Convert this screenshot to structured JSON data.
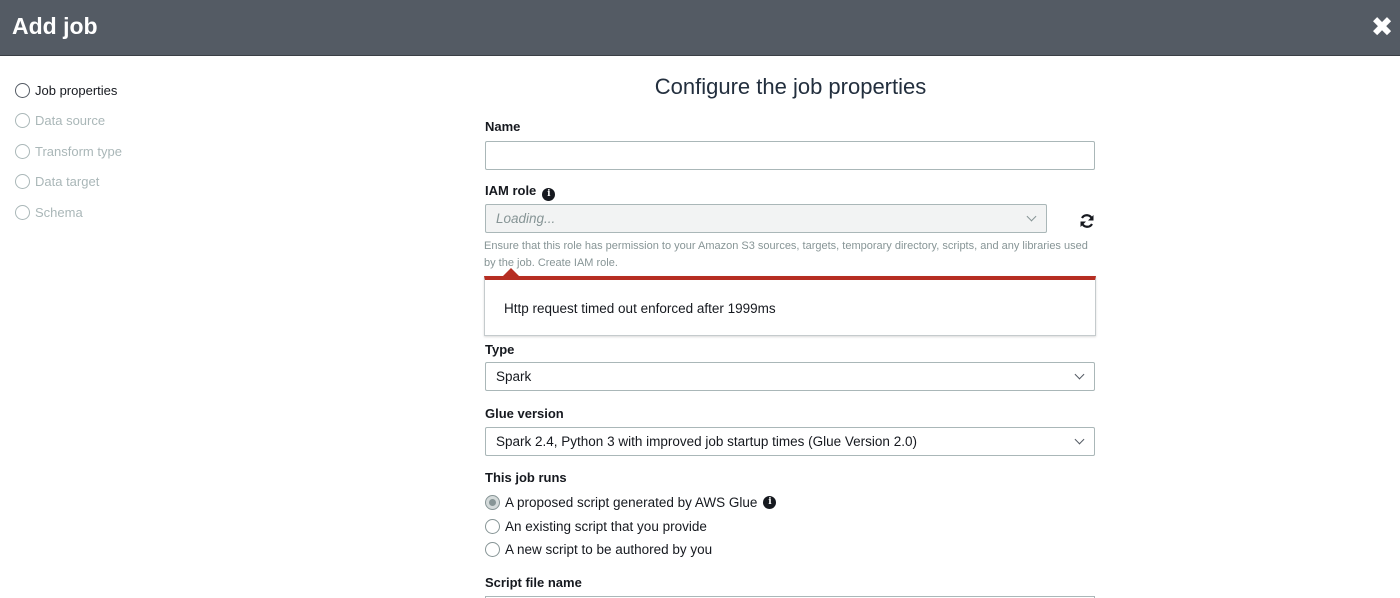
{
  "header": {
    "title": "Add job",
    "close_icon": "close-icon"
  },
  "sidebar": {
    "steps": [
      {
        "label": "Job properties",
        "state": "active"
      },
      {
        "label": "Data source",
        "state": "inactive"
      },
      {
        "label": "Transform type",
        "state": "inactive"
      },
      {
        "label": "Data target",
        "state": "inactive"
      },
      {
        "label": "Schema",
        "state": "inactive"
      }
    ]
  },
  "form": {
    "title": "Configure the job properties",
    "name": {
      "label": "Name",
      "value": ""
    },
    "iam_role": {
      "label": "IAM role",
      "selected": "Loading...",
      "hint": "Ensure that this role has permission to your Amazon S3 sources, targets, temporary directory, scripts, and any libraries used by the job. Create IAM role.",
      "refresh_icon": "refresh-icon",
      "info_icon": "info-icon"
    },
    "error_message": "Http request timed out enforced after 1999ms",
    "type": {
      "label": "Type",
      "selected": "Spark"
    },
    "glue_version": {
      "label": "Glue version",
      "selected": "Spark 2.4, Python 3 with improved job startup times (Glue Version 2.0)"
    },
    "job_runs": {
      "label": "This job runs",
      "options": [
        {
          "label": "A proposed script generated by AWS Glue",
          "checked": true,
          "has_info": true
        },
        {
          "label": "An existing script that you provide",
          "checked": false
        },
        {
          "label": "A new script to be authored by you",
          "checked": false
        }
      ]
    },
    "script_file_name": {
      "label": "Script file name"
    }
  },
  "colors": {
    "header_bg": "#545b64",
    "error_accent": "#b62d22"
  }
}
